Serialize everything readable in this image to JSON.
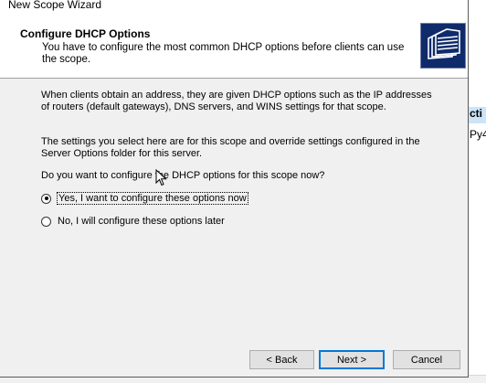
{
  "window": {
    "title": "New Scope Wizard"
  },
  "header": {
    "title": "Configure DHCP Options",
    "description": "You have to configure the most common DHCP options before clients can use the scope.",
    "icon": "folders-wizard-icon"
  },
  "body": {
    "paragraph1": "When clients obtain an address, they are given DHCP options such as the IP addresses of routers (default gateways), DNS servers, and WINS settings for that scope.",
    "paragraph2": "The settings you select here are for this scope and override settings configured in the Server Options folder for this server.",
    "question": "Do you want to configure the DHCP options for this scope now?",
    "options": [
      {
        "label": "Yes, I want to configure these options now",
        "checked": true
      },
      {
        "label": "No, I will configure these options later",
        "checked": false
      }
    ]
  },
  "buttons": {
    "back": "< Back",
    "next": "Next >",
    "cancel": "Cancel"
  },
  "background_app": {
    "text1": "cti",
    "text2": "Py4"
  },
  "colors": {
    "dialog_bg": "#f0f0f0",
    "header_bg": "#ffffff",
    "focus_blue": "#0078d7",
    "icon_navy": "#0f2b6b"
  }
}
